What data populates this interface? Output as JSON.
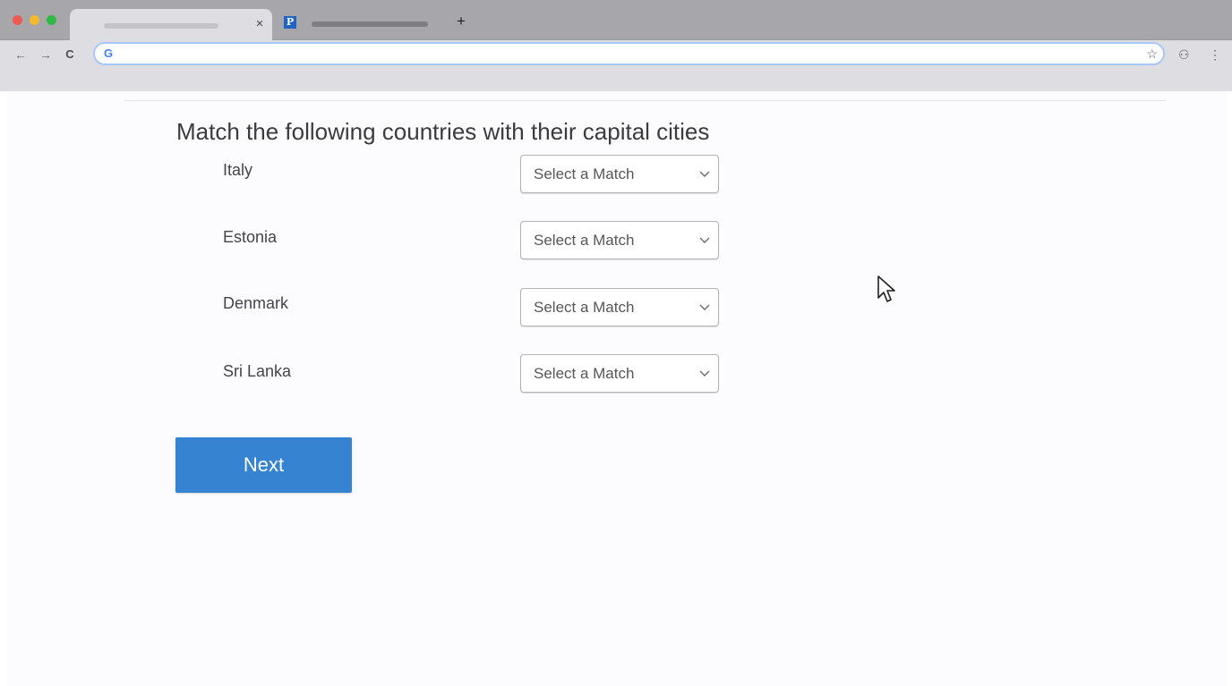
{
  "browser": {
    "tab_close_glyph": "×",
    "new_tab_glyph": "+",
    "inactive_tab_favicon": "P",
    "back_glyph": "←",
    "forward_glyph": "→",
    "reload_glyph": "C",
    "address_value": "",
    "google_glyph": "G",
    "bookmark_glyph": "☆",
    "extension_glyph": "⚇",
    "menu_glyph": "⋮"
  },
  "quiz": {
    "heading": "Match the following countries with their capital cities",
    "rows": [
      {
        "country": "Italy",
        "selected": "Select a Match"
      },
      {
        "country": "Estonia",
        "selected": "Select a Match"
      },
      {
        "country": "Denmark",
        "selected": "Select a Match"
      },
      {
        "country": "Sri Lanka",
        "selected": "Select a Match"
      }
    ],
    "next_label": "Next"
  },
  "colors": {
    "accent": "#3583d1",
    "page_bg": "#fcfcfe",
    "tabstrip_bg": "#a6a6ab",
    "toolbar_bg": "#dedee2"
  }
}
